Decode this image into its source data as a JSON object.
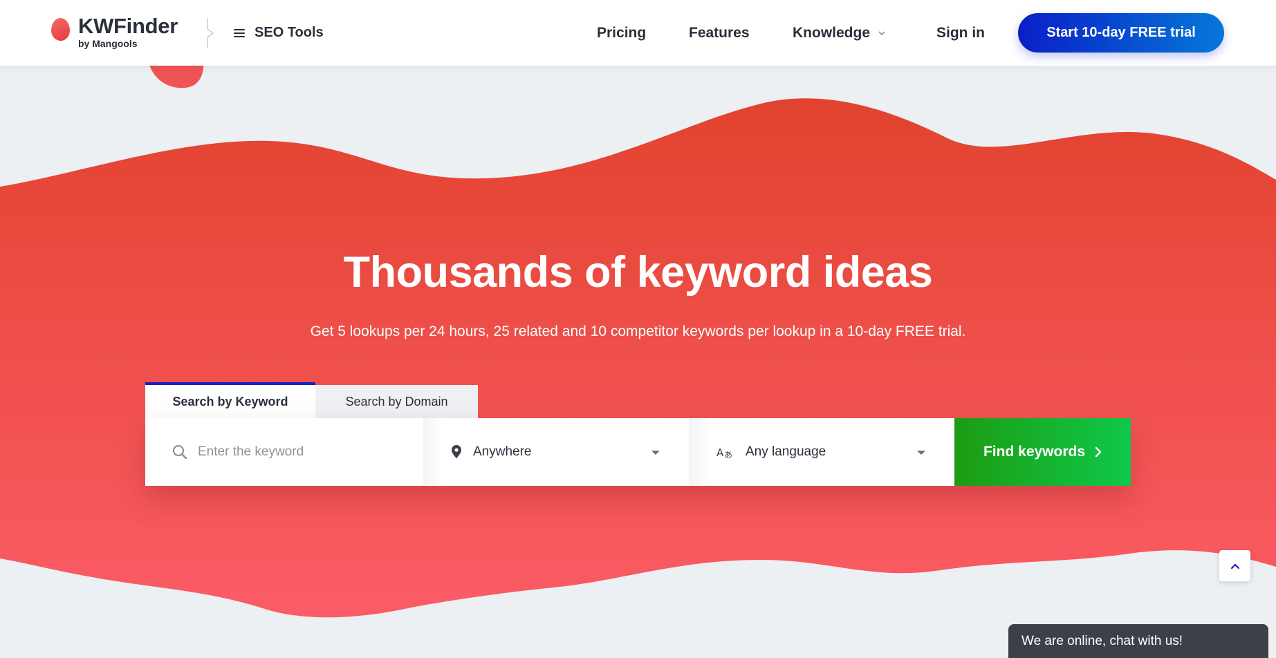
{
  "header": {
    "logo_title": "KWFinder",
    "logo_sub": "by Mangools",
    "seo_tools_label": "SEO Tools",
    "nav": {
      "pricing": "Pricing",
      "features": "Features",
      "knowledge": "Knowledge",
      "signin": "Sign in"
    },
    "cta_label": "Start 10-day FREE trial"
  },
  "hero": {
    "title": "Thousands of keyword ideas",
    "subtitle": "Get 5 lookups per 24 hours, 25 related and 10 competitor keywords per lookup in a 10-day FREE trial."
  },
  "search": {
    "tabs": [
      {
        "label": "Search by Keyword",
        "active": true
      },
      {
        "label": "Search by Domain",
        "active": false
      }
    ],
    "keyword_placeholder": "Enter the keyword",
    "keyword_value": "",
    "location_value": "Anywhere",
    "language_value": "Any language",
    "submit_label": "Find keywords"
  },
  "chat": {
    "label": "We are online, chat with us!"
  },
  "colors": {
    "brand_red": "#e63b3b",
    "cta_blue": "#0a1fc7",
    "find_green": "#1c9c12",
    "tab_accent": "#1c1ec9"
  },
  "icons": [
    "logo-blob-icon",
    "hamburger-icon",
    "chevron-down-icon",
    "search-icon",
    "location-pin-icon",
    "translate-icon",
    "arrow-right-icon",
    "chevron-up-icon"
  ]
}
